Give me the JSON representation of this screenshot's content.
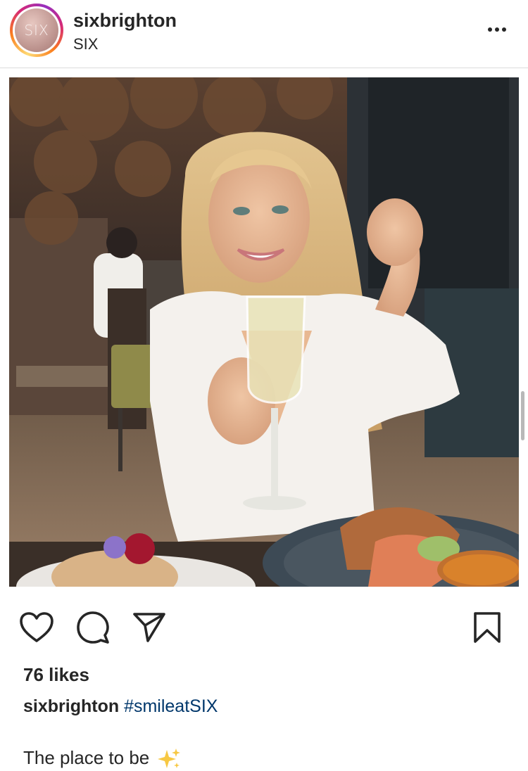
{
  "post": {
    "username": "sixbrighton",
    "location": "SIX",
    "avatar_text": "SIX",
    "more_icon": "more-horizontal-icon"
  },
  "photo": {
    "accent_dress": "#f4f1ed",
    "accent_hair": "#d6b27a"
  },
  "actions": {
    "like_icon": "heart-icon",
    "comment_icon": "comment-icon",
    "share_icon": "send-icon",
    "save_icon": "bookmark-icon"
  },
  "likes": "76 likes",
  "caption": {
    "username": "sixbrighton",
    "hashtag": "#smileatSIX",
    "text": "The place to be",
    "emoji": "sparkles-icon"
  },
  "colors": {
    "text": "#262626",
    "hashtag": "#00376b",
    "divider": "#dbdbdb"
  }
}
